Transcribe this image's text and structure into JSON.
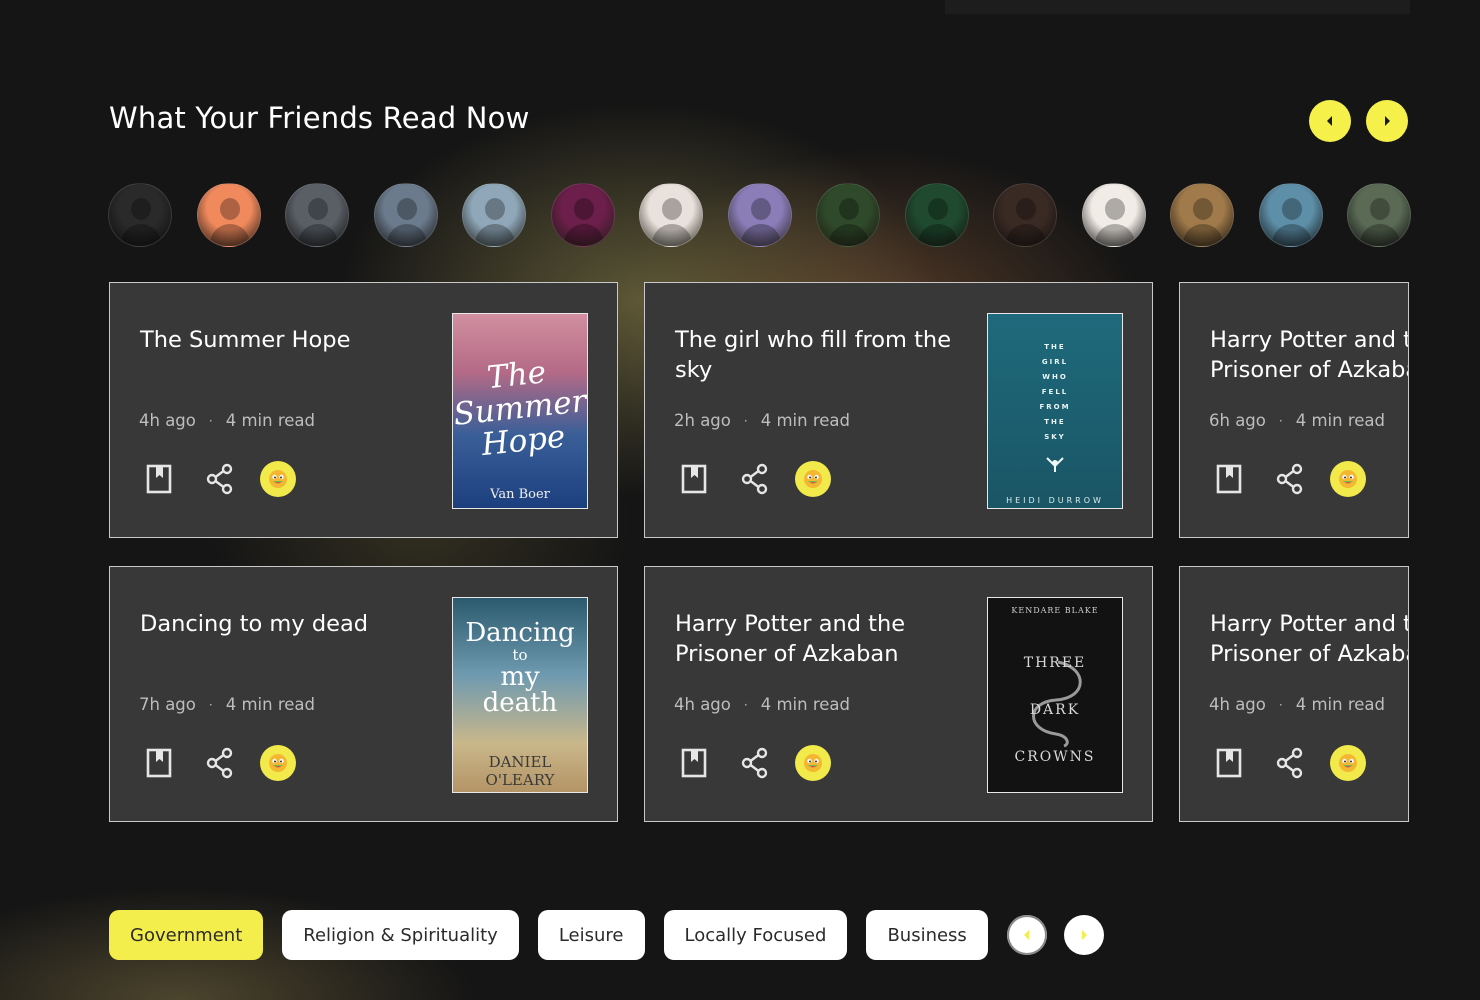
{
  "section": {
    "title": "What Your Friends Read Now",
    "prev_icon": "chevron-left-icon",
    "next_icon": "chevron-right-icon",
    "accent_color": "#f6f04a"
  },
  "friends": [
    {
      "avatar": "friend-avatar-1",
      "color": "#2a2a2a"
    },
    {
      "avatar": "friend-avatar-2",
      "color": "#f08a5d"
    },
    {
      "avatar": "friend-avatar-3",
      "color": "#5a5f66"
    },
    {
      "avatar": "friend-avatar-4",
      "color": "#6b7a8c"
    },
    {
      "avatar": "friend-avatar-5",
      "color": "#8fa7b8"
    },
    {
      "avatar": "friend-avatar-6",
      "color": "#6b1f4a"
    },
    {
      "avatar": "friend-avatar-7",
      "color": "#e9e2dc"
    },
    {
      "avatar": "friend-avatar-8",
      "color": "#8a7db8"
    },
    {
      "avatar": "friend-avatar-9",
      "color": "#2f4a2a"
    },
    {
      "avatar": "friend-avatar-10",
      "color": "#1f4a2f"
    },
    {
      "avatar": "friend-avatar-11",
      "color": "#3a2a24"
    },
    {
      "avatar": "friend-avatar-12",
      "color": "#f2ece6"
    },
    {
      "avatar": "friend-avatar-13",
      "color": "#a07a4a"
    },
    {
      "avatar": "friend-avatar-14",
      "color": "#5e8fa8"
    },
    {
      "avatar": "friend-avatar-15",
      "color": "#5a6a55"
    }
  ],
  "cards": [
    {
      "title": "The Summer Hope",
      "time": "4h ago",
      "read": "4 min read",
      "cover": {
        "style": "cover-1",
        "title": "The Summer Hope",
        "author": "Van Boer"
      }
    },
    {
      "title": "The girl who fill from the sky",
      "time": "2h ago",
      "read": "4 min read",
      "cover": {
        "style": "cover-2",
        "title": "THE GIRL WHO FELL FROM THE SKY",
        "author": "HEIDI DURROW"
      }
    },
    {
      "title": "Harry Potter and the Prisoner of Azkaban",
      "time": "6h ago",
      "read": "4 min read",
      "cover": null
    },
    {
      "title": "Dancing to my dead",
      "time": "7h ago",
      "read": "4 min read",
      "cover": {
        "style": "cover-3",
        "title": "Dancing to my death",
        "author": "DANIEL O'LEARY"
      }
    },
    {
      "title": "Harry Potter and the Prisoner of Azkaban",
      "time": "4h ago",
      "read": "4 min read",
      "cover": {
        "style": "cover-4",
        "title": "THREE DARK CROWNS",
        "author": "KENDARE BLAKE"
      }
    },
    {
      "title": "Harry Potter and the Prisoner of Azkaban",
      "time": "4h ago",
      "read": "4 min read",
      "cover": null
    }
  ],
  "card_actions": {
    "bookmark_icon": "bookmark-icon",
    "share_icon": "share-icon",
    "reaction_icon": "emoji-reaction-icon",
    "separator": "·"
  },
  "categories": {
    "items": [
      "Government",
      "Religion & Spirituality",
      "Leisure",
      "Locally Focused",
      "Business"
    ],
    "active": "Government",
    "prev_icon": "chevron-left-icon",
    "next_icon": "chevron-right-icon"
  }
}
